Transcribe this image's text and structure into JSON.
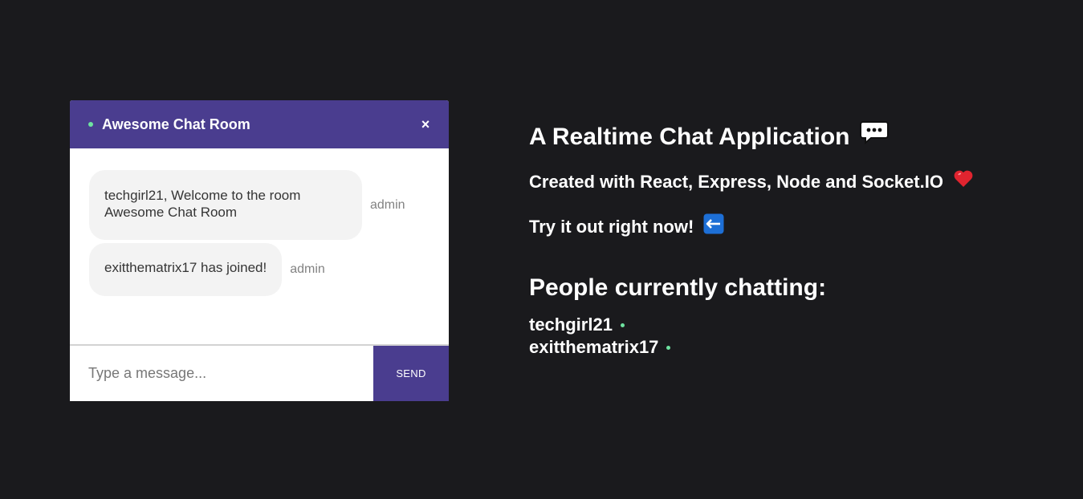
{
  "chat": {
    "room_name": "Awesome Chat Room",
    "close_label": "×",
    "messages": [
      {
        "text": "techgirl21, Welcome to the room Awesome Chat Room",
        "sender": "admin"
      },
      {
        "text": "exitthematrix17 has joined!",
        "sender": "admin"
      }
    ],
    "input_placeholder": "Type a message...",
    "input_value": "",
    "send_label": "SEND"
  },
  "info": {
    "title": "A Realtime Chat Application",
    "title_icon": "speech-balloon-icon",
    "subtitle": "Created with React, Express, Node and Socket.IO",
    "subtitle_icon": "red-heart-icon",
    "cta": "Try it out right now!",
    "cta_icon": "left-arrow-icon",
    "people_heading": "People currently chatting:",
    "people": [
      "techgirl21",
      "exitthematrix17"
    ]
  },
  "colors": {
    "background": "#1a1a1d",
    "accent": "#4a3d8f",
    "online": "#6ee3a0",
    "bubble": "#f3f3f3"
  }
}
